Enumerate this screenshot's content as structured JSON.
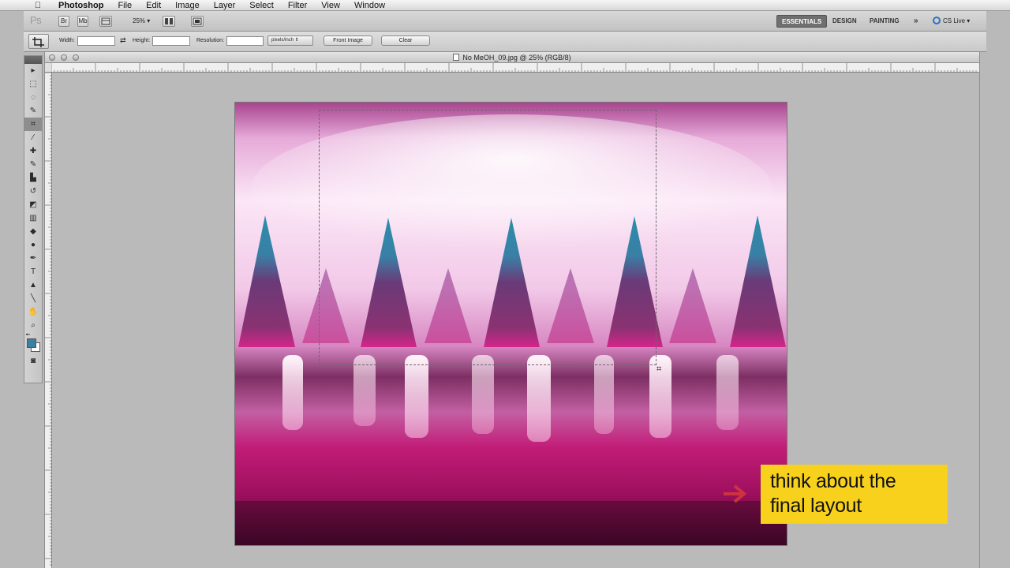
{
  "menubar": {
    "apple_icon": "apple-icon",
    "items": [
      "Photoshop",
      "File",
      "Edit",
      "Image",
      "Layer",
      "Select",
      "Filter",
      "View",
      "Window"
    ]
  },
  "appbar": {
    "logo": "Ps",
    "bridge_label": "Br",
    "minibridge_label": "Mb",
    "zoom": "25%",
    "workspaces": [
      "ESSENTIALS",
      "DESIGN",
      "PAINTING"
    ],
    "active_workspace": "ESSENTIALS",
    "more_icon": "»",
    "cs_live": "CS Live"
  },
  "options": {
    "width_label": "Width:",
    "height_label": "Height:",
    "resolution_label": "Resolution:",
    "unit": "pixels/inch",
    "front_image": "Front Image",
    "clear": "Clear",
    "width_value": "",
    "height_value": "",
    "resolution_value": ""
  },
  "toolbox": {
    "tools": [
      {
        "name": "move",
        "glyph": "▸"
      },
      {
        "name": "marquee",
        "glyph": "⬚"
      },
      {
        "name": "lasso",
        "glyph": "◌"
      },
      {
        "name": "quick-select",
        "glyph": "✎"
      },
      {
        "name": "crop",
        "glyph": "⌗"
      },
      {
        "name": "eyedropper",
        "glyph": "⁄"
      },
      {
        "name": "healing",
        "glyph": "✚"
      },
      {
        "name": "brush",
        "glyph": "✎"
      },
      {
        "name": "stamp",
        "glyph": "▙"
      },
      {
        "name": "history-brush",
        "glyph": "↺"
      },
      {
        "name": "eraser",
        "glyph": "◩"
      },
      {
        "name": "gradient",
        "glyph": "▥"
      },
      {
        "name": "blur",
        "glyph": "◆"
      },
      {
        "name": "dodge",
        "glyph": "●"
      },
      {
        "name": "pen",
        "glyph": "✒"
      },
      {
        "name": "type",
        "glyph": "T"
      },
      {
        "name": "path-select",
        "glyph": "▲"
      },
      {
        "name": "line",
        "glyph": "╲"
      },
      {
        "name": "hand",
        "glyph": "✋"
      },
      {
        "name": "zoom",
        "glyph": "⌕"
      }
    ],
    "active_tool": "crop",
    "foreground_color": "#3c7fa4",
    "background_color": "#ffffff",
    "quick_mask_glyph": "◙"
  },
  "document": {
    "title": "No MeOH_09.jpg @ 25% (RGB/8)"
  },
  "callout": {
    "line1": "think about the",
    "line2": "final layout",
    "color": "#f7d11c",
    "arrow_color": "#d63a3a"
  }
}
